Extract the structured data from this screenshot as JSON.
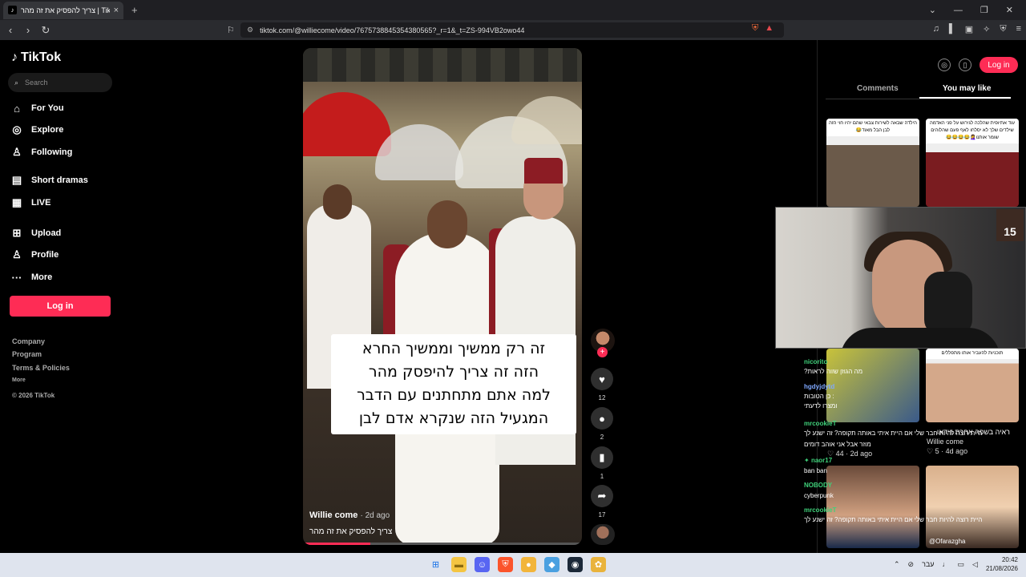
{
  "browser": {
    "tab_title": "צריך להפסיק את זה מהר | TikTok",
    "tab_close": "×",
    "new_tab": "+",
    "url": "tiktok.com/@williecome/video/7675738845354380565?_r=1&_t=ZS-994VB2owo44"
  },
  "sidebar": {
    "logo": "TikTok",
    "search_placeholder": "Search",
    "items": [
      {
        "label": "For You",
        "icon": "home-icon"
      },
      {
        "label": "Explore",
        "icon": "compass-icon"
      },
      {
        "label": "Following",
        "icon": "following-icon"
      },
      {
        "label": "Short dramas",
        "icon": "film-icon"
      },
      {
        "label": "LIVE",
        "icon": "live-icon"
      },
      {
        "label": "Upload",
        "icon": "upload-icon"
      },
      {
        "label": "Profile",
        "icon": "profile-icon"
      },
      {
        "label": "More",
        "icon": "more-icon"
      }
    ],
    "login_label": "Log in",
    "footer": [
      "Company",
      "Program",
      "Terms & Policies",
      "More",
      "© 2026 TikTok"
    ]
  },
  "video": {
    "caption_lines": [
      "זה רק ממשיך וממשיך החרא",
      "הזה זה צריך להיפסק מהר",
      "למה אתם מתחתנים עם הדבר",
      "המגעיל הזה שנקרא אדם לבן"
    ],
    "author": "Willie come",
    "time_ago": "· 2d ago",
    "description": "צריך להפסיק את זה מהר",
    "progress": 0.24
  },
  "actions": {
    "likes": "12",
    "comments": "2",
    "saves": "1",
    "shares": "17"
  },
  "right_panel": {
    "login_label": "Log in",
    "tabs": [
      "Comments",
      "You may like"
    ],
    "active_tab": "You may like",
    "thumb1_text": "הילדה שבאה לשירות צבאי שהם יהיו חוי הזה לבן הבל מאוד😂",
    "thumb2_text": "עוד אתיופית שהלכה לגירוש על פני האדמה שילדים שלך לא יסלחו לאף פעם שהלוהים שומר אותנו🤦‍♀️😂😂😂😂",
    "thumb4_text": "תוכניות להעביר אותו מתפללים",
    "thumb3_title": "היית רוצה להיות חבר שלי אם היית איתי בתקופה הזו",
    "thumb3_likes": "44",
    "thumb3_time": "· 2d ago",
    "thumb4_title": "ראיה בשפה אחרת ווידאו",
    "thumb4_author": "Willie come",
    "thumb4_likes": "5",
    "thumb4_time": "· 4d ago",
    "thumb6_text": "@Ofarazgha"
  },
  "chat": [
    {
      "user": "nicorito",
      "text": "?מה הגוזן שווה לראות"
    },
    {
      "user": "hgdyjdytd",
      "text": "כן הטובות :"
    },
    {
      "user": "",
      "text": "ומצרו לדעתי"
    },
    {
      "user": "mrcookieT",
      "text": "היית רוצה להיות חבר שלי אם היית איתי באותה תקופה? זה ישנע לך"
    },
    {
      "user": "",
      "text": "מוזר אבל אני אוהב דומים"
    },
    {
      "user": "naor17",
      "text": ""
    },
    {
      "user": "",
      "text": "ban ban"
    },
    {
      "user": "NOBODY",
      "text": ""
    },
    {
      "user": "",
      "text": "cyberpunk"
    },
    {
      "user": "mrcookieT",
      "text": "היית רוצה להיות חבר שלי אם היית איתי באותה תקופה? זה ישנע לך"
    }
  ],
  "webcam": {
    "badge": "15"
  },
  "taskbar": {
    "lang": "עבר",
    "time": "20:42",
    "date": "21/08/2026"
  },
  "colors": {
    "accent": "#fe2c55",
    "chat_user": "#3fd17a"
  }
}
